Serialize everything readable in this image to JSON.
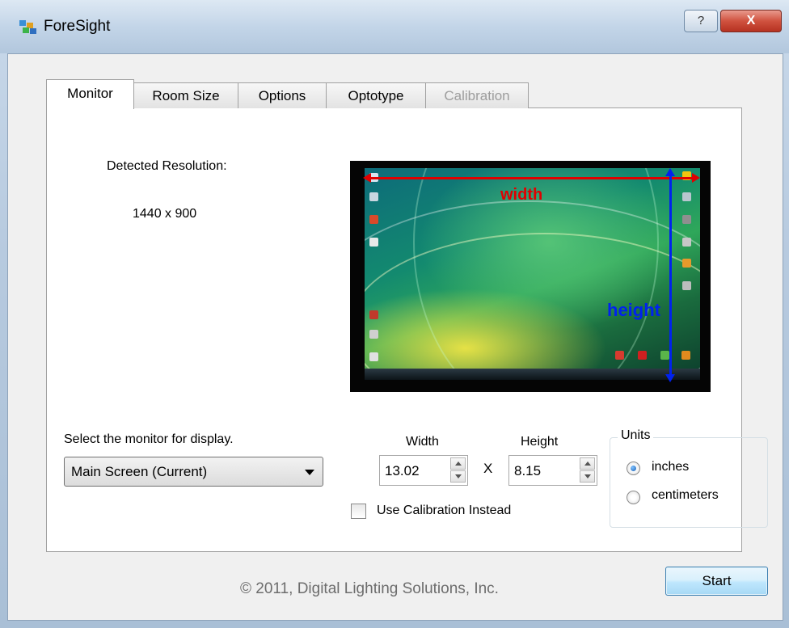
{
  "window": {
    "title": "ForeSight",
    "help_label": "?",
    "close_label": "X"
  },
  "tabs": [
    {
      "label": "Monitor",
      "state": "active"
    },
    {
      "label": "Room Size",
      "state": "normal"
    },
    {
      "label": "Options",
      "state": "normal"
    },
    {
      "label": "Optotype",
      "state": "normal"
    },
    {
      "label": "Calibration",
      "state": "disabled"
    }
  ],
  "monitor": {
    "detected_label": "Detected Resolution:",
    "resolution": "1440 x 900",
    "preview": {
      "width_label": "width",
      "height_label": "height"
    },
    "select_label": "Select the monitor for display.",
    "selected_monitor": "Main Screen (Current)",
    "width_header": "Width",
    "height_header": "Height",
    "width_value": "13.02",
    "height_value": "8.15",
    "times_label": "X",
    "use_calibration_label": "Use Calibration Instead",
    "use_calibration_checked": false,
    "units": {
      "legend": "Units",
      "options": [
        {
          "label": "inches",
          "checked": true
        },
        {
          "label": "centimeters",
          "checked": false
        }
      ]
    }
  },
  "footer": {
    "copyright": "© 2011, Digital Lighting Solutions, Inc.",
    "start_label": "Start"
  },
  "colors": {
    "width_arrow": "#e00000",
    "height_arrow": "#0022ee",
    "close_button": "#c7432f"
  }
}
